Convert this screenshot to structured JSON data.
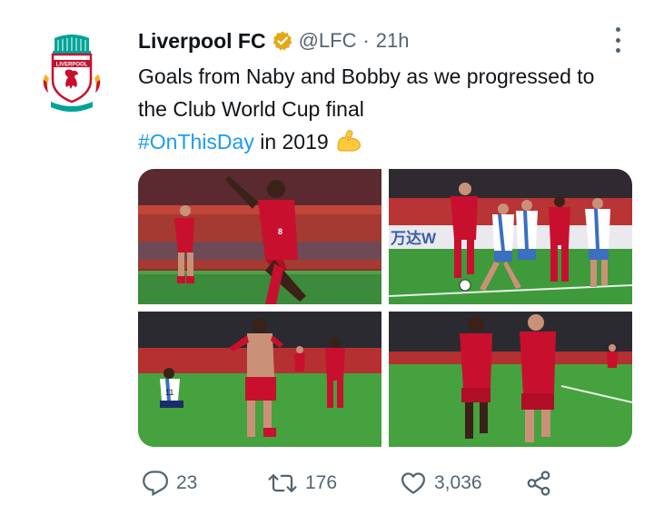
{
  "tweet": {
    "author_name": "Liverpool FC",
    "handle": "@LFC",
    "separator": "·",
    "time_ago": "21h",
    "text_main": "Goals from Naby and Bobby as we progressed to the Club World Cup final",
    "hashtag": "#OnThisDay",
    "text_tail": " in 2019",
    "emoji_icon": "flexed-biceps-emoji",
    "verified_icon": "verified-badge-icon",
    "avatar_icon": "liverpool-crest-logo",
    "avatar_text": "LIVERPOOL FOOTBALL CLUB",
    "more_icon": "more-vertical-icon"
  },
  "media": {
    "photos": [
      {
        "name": "photo-celebration-running"
      },
      {
        "name": "photo-players-attacking"
      },
      {
        "name": "photo-firmino-celebration"
      },
      {
        "name": "photo-players-running"
      }
    ],
    "photo_texts": {
      "scoreboard_text": "万达W"
    }
  },
  "actions": {
    "reply_count": "23",
    "retweet_count": "176",
    "like_count": "3,036",
    "reply_icon": "reply-bubble-icon",
    "retweet_icon": "retweet-icon",
    "like_icon": "heart-icon",
    "share_icon": "share-icon"
  },
  "colors": {
    "text": "#0f1419",
    "secondary": "#536471",
    "hashtag": "#1d9bf0",
    "verified": "#e2a817",
    "liverpool_red": "#c8102e"
  }
}
